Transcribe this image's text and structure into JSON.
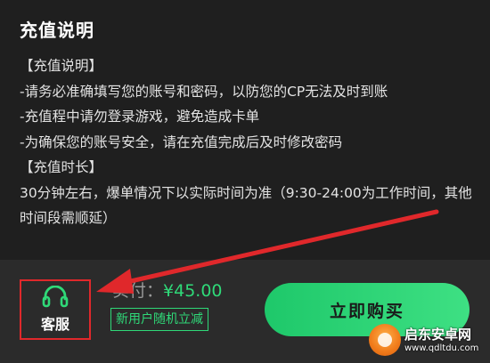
{
  "panel": {
    "title": "充值说明",
    "lines": [
      "【充值说明】",
      "-请务必准确填写您的账号和密码，以防您的CP无法及时到账",
      "-充值程中请勿登录游戏，避免造成卡单",
      "-为确保您的账号安全，请在充值完成后及时修改密码",
      "【充值时长】",
      "30分钟左右，爆单情况下以实际时间为准（9:30-24:00为工作时间，其他时间段需顺延）"
    ]
  },
  "footer": {
    "support_label": "客服",
    "price_prefix": "实付：",
    "price": "¥45.00",
    "promo": "新用户随机立减",
    "buy_label": "立即购买"
  },
  "watermark": {
    "name": "启东安卓网",
    "url": "www.qdltdu.com"
  },
  "colors": {
    "accent": "#2fd978",
    "highlight": "#e0282b",
    "background": "#1f1f1f",
    "footer_bg": "#2b2b2b"
  },
  "icons": {
    "support": "headset-icon",
    "annotation": "red-arrow-icon",
    "watermark_logo": "watermark-logo-icon"
  }
}
